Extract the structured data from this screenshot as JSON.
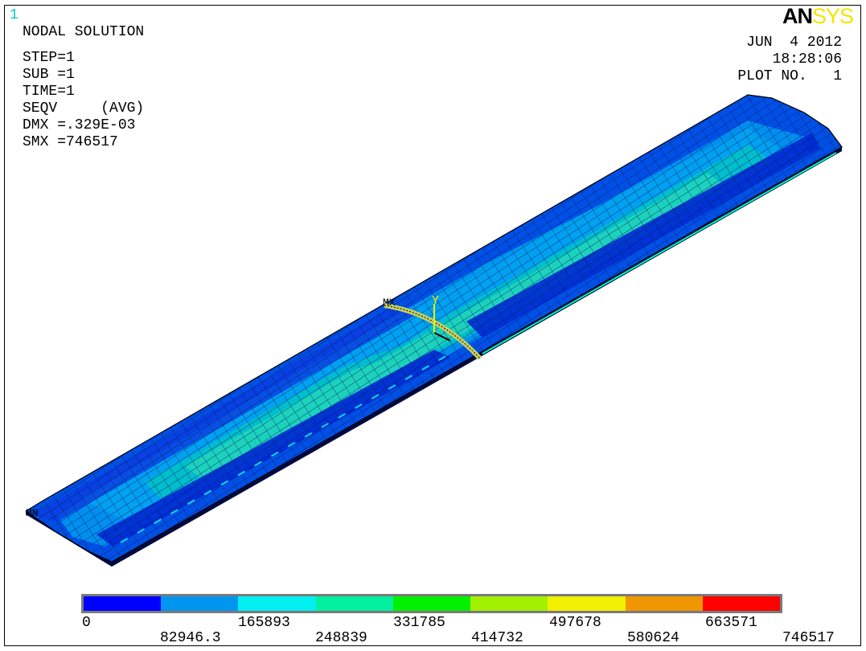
{
  "window": {
    "number": "1"
  },
  "logo": {
    "an": "AN",
    "sys": "SYS"
  },
  "header": {
    "title": "NODAL SOLUTION",
    "lines": [
      "STEP=1",
      "SUB =1",
      "TIME=1",
      "SEQV     (AVG)",
      "DMX =.329E-03",
      "SMX =746517"
    ]
  },
  "plot_info": {
    "date": "JUN  4 2012",
    "time": "18:28:06",
    "plot_no": "PLOT NO.   1"
  },
  "model_labels": {
    "mx": "MX",
    "mn": "MN",
    "axis_y": "Y"
  },
  "legend": {
    "colors": [
      "#0000ff",
      "#0096f0",
      "#00f0f0",
      "#00f0a0",
      "#00f000",
      "#a0f000",
      "#f0f000",
      "#f09600",
      "#ff0000"
    ],
    "labels_top": [
      "0",
      "165893",
      "331785",
      "497678",
      "663571"
    ],
    "labels_bottom": [
      "82946.3",
      "248839",
      "414732",
      "580624",
      "746517"
    ]
  }
}
